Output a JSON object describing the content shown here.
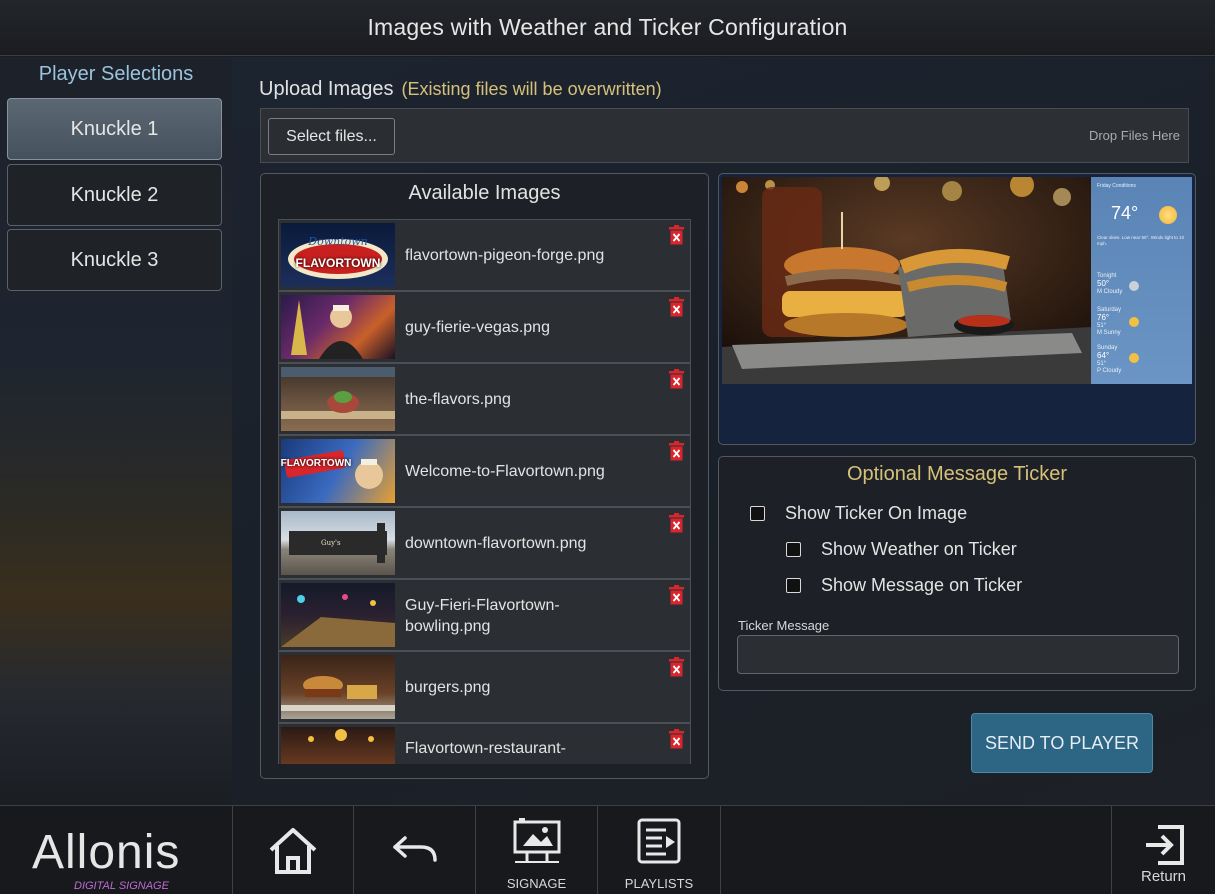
{
  "header": {
    "title": "Images with Weather and Ticker Configuration"
  },
  "sidebar": {
    "title": "Player Selections",
    "players": [
      {
        "label": "Knuckle 1",
        "active": true
      },
      {
        "label": "Knuckle 2",
        "active": false
      },
      {
        "label": "Knuckle 3",
        "active": false
      }
    ]
  },
  "upload": {
    "label": "Upload Images",
    "note": "(Existing files will be overwritten)",
    "select_label": "Select files...",
    "drop_text": "Drop Files Here"
  },
  "images": {
    "title": "Available Images",
    "items": [
      {
        "name": "flavortown-pigeon-forge.png",
        "thumb_text": "FLAVORTOWN"
      },
      {
        "name": "guy-fierie-vegas.png",
        "thumb_text": ""
      },
      {
        "name": "the-flavors.png",
        "thumb_text": ""
      },
      {
        "name": "Welcome-to-Flavortown.png",
        "thumb_text": "FLAVORTOWN"
      },
      {
        "name": "downtown-flavortown.png",
        "thumb_text": ""
      },
      {
        "name": "Guy-Fieri-Flavortown-bowling.png",
        "thumb_text": ""
      },
      {
        "name": "burgers.png",
        "thumb_text": ""
      },
      {
        "name": "Flavortown-restaurant-",
        "thumb_text": ""
      }
    ]
  },
  "preview": {
    "weather": {
      "header": "Friday Conditions",
      "temp": "74°",
      "desc": "Clear skies. Low near 50°. Winds light to 10 mph.",
      "days": [
        {
          "day": "Tonight",
          "temp": "50°",
          "cond": "M Cloudy"
        },
        {
          "day": "Saturday",
          "temp": "76°",
          "low": "51°",
          "cond": "M Sunny"
        },
        {
          "day": "Sunday",
          "temp": "64°",
          "low": "51°",
          "cond": "P Cloudy"
        }
      ]
    }
  },
  "ticker": {
    "title": "Optional Message Ticker",
    "show_on_image": "Show Ticker On Image",
    "show_weather": "Show Weather on Ticker",
    "show_message": "Show Message on Ticker",
    "message_label": "Ticker Message",
    "message_value": ""
  },
  "send_label": "SEND TO PLAYER",
  "nav": {
    "logo": "Allonis",
    "logo_sub": "DIGITAL SIGNAGE",
    "signage": "SIGNAGE",
    "playlists": "PLAYLISTS",
    "return": "Return"
  },
  "colors": {
    "accent_gold": "#d6c17a",
    "sidebar_title": "#9cc3de",
    "send_button": "#2d6585",
    "trash_red": "#d8262c"
  }
}
